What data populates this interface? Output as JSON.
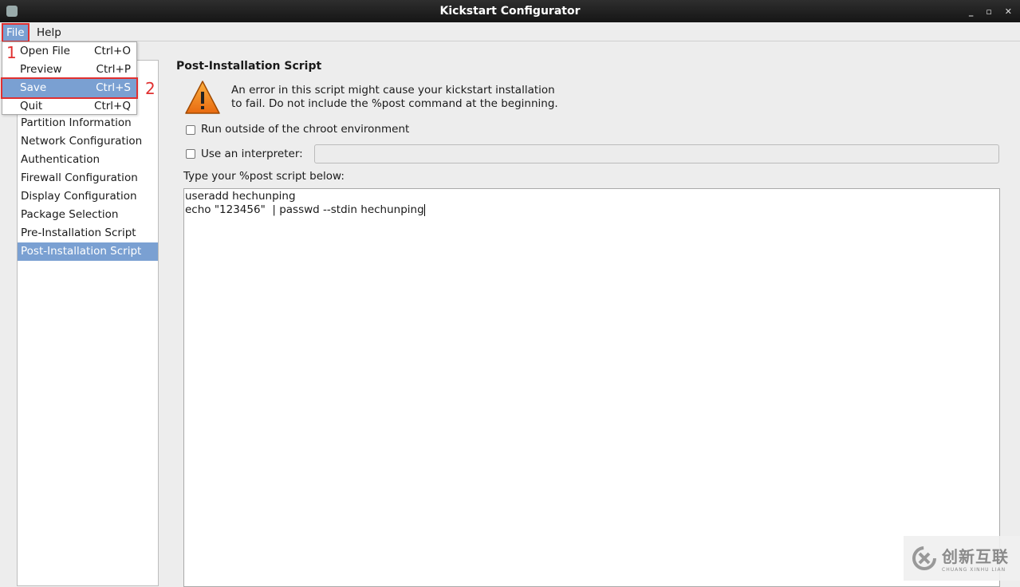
{
  "window": {
    "title": "Kickstart Configurator",
    "controls": [
      "_",
      "▫",
      "✕"
    ]
  },
  "menubar": {
    "items": [
      "File",
      "Help"
    ]
  },
  "file_menu": {
    "items": [
      {
        "label": "Open File",
        "shortcut": "Ctrl+O"
      },
      {
        "label": "Preview",
        "shortcut": "Ctrl+P"
      },
      {
        "label": "Save",
        "shortcut": "Ctrl+S",
        "highlighted": true
      },
      {
        "label": "Quit",
        "shortcut": "Ctrl+Q"
      }
    ]
  },
  "annotations": [
    "1",
    "2"
  ],
  "sidebar": {
    "items": [
      "Partition Information",
      "Network Configuration",
      "Authentication",
      "Firewall Configuration",
      "Display Configuration",
      "Package Selection",
      "Pre-Installation Script",
      "Post-Installation Script"
    ],
    "selected": "Post-Installation Script"
  },
  "main": {
    "heading": "Post-Installation Script",
    "warning_line1": "An error in this script might cause your kickstart installation",
    "warning_line2": "to fail. Do not include the %post command at the beginning.",
    "chroot_label": "Run outside of the chroot environment",
    "chroot_checked": false,
    "interpreter_label": "Use an interpreter:",
    "interpreter_checked": false,
    "interpreter_value": "",
    "script_label": "Type your %post script below:",
    "script_lines": [
      "useradd hechunping",
      "echo \"123456\"  | passwd --stdin hechunping"
    ]
  },
  "watermark": {
    "cn": "创新互联",
    "en": "CHUANG XINHU LIAN"
  },
  "colors": {
    "selection": "#7aa0d2",
    "annotation": "#e03030"
  }
}
